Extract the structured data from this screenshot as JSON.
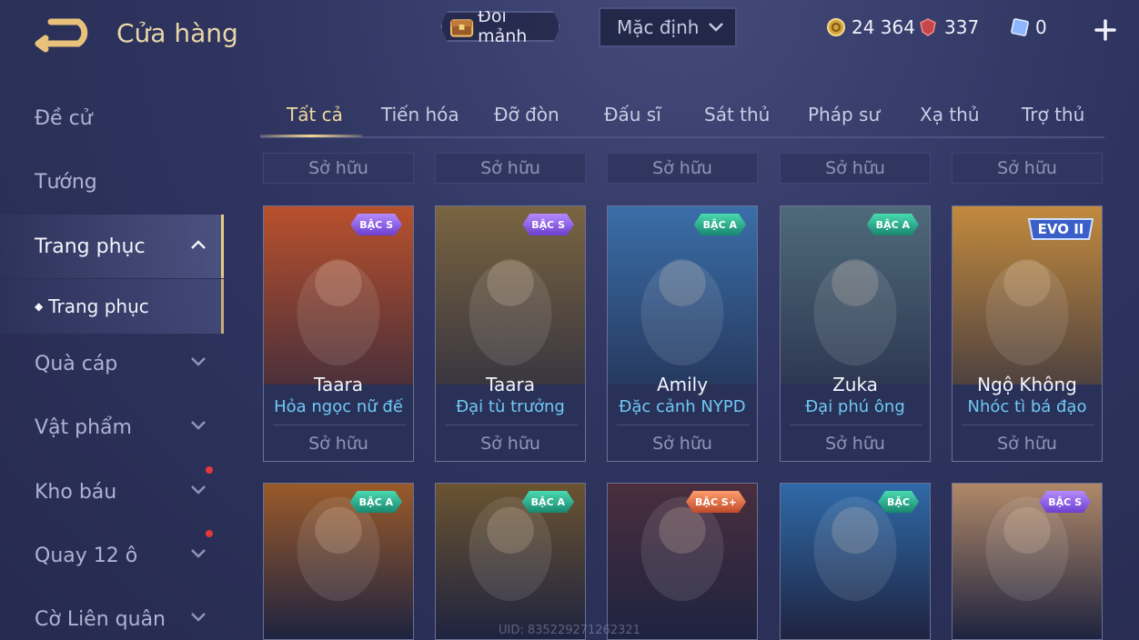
{
  "header": {
    "title": "Cửa hàng",
    "exchange_label": "Đổi mảnh",
    "sort_value": "Mặc định",
    "currencies": [
      {
        "icon": "gold-coin-icon",
        "value": "24 364"
      },
      {
        "icon": "red-gem-icon",
        "value": "337"
      },
      {
        "icon": "voucher-icon",
        "value": "0"
      }
    ]
  },
  "sidebar": {
    "items": [
      {
        "label": "Đề cử"
      },
      {
        "label": "Tướng"
      },
      {
        "label": "Trang phục"
      },
      {
        "label": "Quà cáp"
      },
      {
        "label": "Vật phẩm"
      },
      {
        "label": "Kho báu"
      },
      {
        "label": "Quay 12 ô"
      },
      {
        "label": "Cờ Liên quân"
      }
    ],
    "sub_item": "Trang phục"
  },
  "tabs": [
    "Tất cả",
    "Tiến hóa",
    "Đỡ đòn",
    "Đấu sĩ",
    "Sát thủ",
    "Pháp sư",
    "Xạ thủ",
    "Trợ thủ"
  ],
  "status_owned": "Sở hữu",
  "cards_row1": [
    {
      "hero": "Taara",
      "skin": "Hỏa ngọc nữ đế",
      "tier": "BẬC S",
      "status": "Sở hữu",
      "accent": "#b8502c"
    },
    {
      "hero": "Taara",
      "skin": "Đại tù trưởng",
      "tier": "BẬC S",
      "status": "Sở hữu",
      "accent": "#7a6440"
    },
    {
      "hero": "Amily",
      "skin": "Đặc cảnh NYPD",
      "tier": "BẬC A",
      "status": "Sở hữu",
      "accent": "#3a6ea8"
    },
    {
      "hero": "Zuka",
      "skin": "Đại phú ông",
      "tier": "BẬC A",
      "status": "Sở hữu",
      "accent": "#4f6a7a"
    },
    {
      "hero": "Ngộ Không",
      "skin": "Nhóc tì bá đạo",
      "tier": "EVO II",
      "status": "Sở hữu",
      "accent": "#c28a3e"
    }
  ],
  "cards_row2": [
    {
      "tier": "BẬC A",
      "accent": "#9a5a2a"
    },
    {
      "tier": "BẬC A",
      "accent": "#6a5330"
    },
    {
      "tier": "BẬC S+",
      "accent": "#4a2e3e"
    },
    {
      "tier": "BẬC",
      "accent": "#2f6aa8"
    },
    {
      "tier": "BẬC S",
      "accent": "#b08868"
    }
  ],
  "uid_text": "UID: 835229271262321"
}
